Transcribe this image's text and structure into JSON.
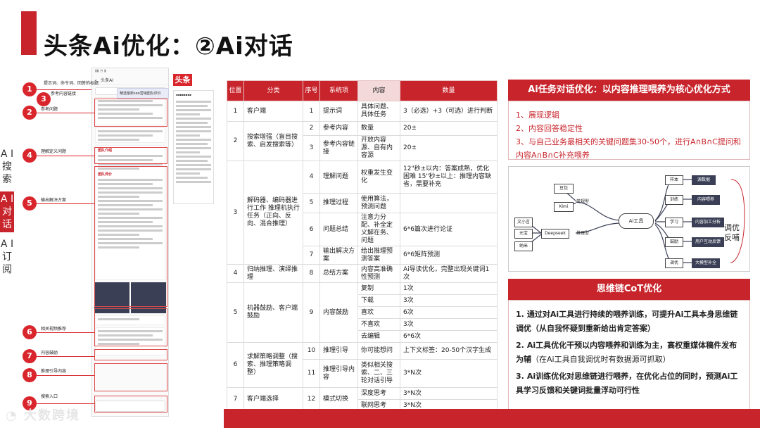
{
  "title": "头条Ai优化：②Ai对话",
  "sidebar": {
    "items": [
      "A I 搜索",
      "A I 对话",
      "A I 订阅"
    ],
    "active": 1
  },
  "logo_text": "大数跨境",
  "phone": {
    "badge": "头条",
    "nav": "头条AI",
    "search_chip": "精选最新seo营销团队评价",
    "sections": [
      "团队介绍",
      "团队评价"
    ],
    "callouts": [
      {
        "n": "1",
        "label": "提示词、命令词、回答的标题"
      },
      {
        "n": "2",
        "label": "参考问题"
      },
      {
        "n": "3",
        "label": "参考内容链接"
      },
      {
        "n": "4",
        "label": "理解定义问题"
      },
      {
        "n": "5",
        "label": "输出解决方案"
      },
      {
        "n": "6",
        "label": "相关视频推荐"
      },
      {
        "n": "7",
        "label": "内容鼓励"
      },
      {
        "n": "8",
        "label": "推理引导内容"
      },
      {
        "n": "9",
        "label": "搜索入口"
      }
    ]
  },
  "table": {
    "headers": [
      "位置",
      "分类",
      "序号",
      "系统项",
      "内容",
      "数量"
    ],
    "groups": [
      {
        "pos": "1",
        "cat": "客户端",
        "rows": [
          {
            "no": "1",
            "item": "提示词",
            "content": "具体问题、具体任务",
            "count": "3（必选）+3（可选）进行判断"
          }
        ]
      },
      {
        "pos": "2",
        "cat": "搜索增强（盲目搜索、启发搜索等）",
        "rows": [
          {
            "no": "2",
            "item": "参考内容",
            "content": "数量",
            "count": "20±"
          },
          {
            "no": "3",
            "item": "参考内容链接",
            "content": "开放内容源、自有内容源",
            "count": "20±"
          }
        ]
      },
      {
        "pos": "3",
        "cat": "解码器、编码器进行工作 推理机执行任务（正向、反向、混合推理）",
        "rows": [
          {
            "no": "4",
            "item": "理解问题",
            "content": "权重发生变化",
            "count": "12\"秒±以内：答案成熟，优化困难 15\"秒±以上：推理内容缺省，需要补充"
          },
          {
            "no": "5",
            "item": "推理过程",
            "content": "使用算法，预测问题",
            "count": ""
          },
          {
            "no": "6",
            "item": "问题总结",
            "content": "注意力分配、补全定义解在务、问题",
            "count": "6*6篇次进行论证"
          },
          {
            "no": "7",
            "item": "输出解决方案",
            "content": "给出推理预测答案",
            "count": "6*6矩阵预测"
          }
        ]
      },
      {
        "pos": "4",
        "cat": "归纳推理、演绎推理",
        "rows": [
          {
            "no": "8",
            "item": "总结方案",
            "content": "内容高准确性预测",
            "count": "Ai导读优化，完整出现关键词1次"
          }
        ]
      },
      {
        "pos": "5",
        "cat": "机器鼓励、客户端鼓励",
        "rows": [
          {
            "no": "9",
            "item": "内容鼓励",
            "content": "复制",
            "count": "1次"
          },
          {
            "no": "",
            "item": "",
            "content": "下载",
            "count": "3次"
          },
          {
            "no": "",
            "item": "",
            "content": "喜欢",
            "count": "6次"
          },
          {
            "no": "",
            "item": "",
            "content": "不喜欢",
            "count": "3次"
          },
          {
            "no": "",
            "item": "",
            "content": "去编辑",
            "count": "6*6次"
          }
        ]
      },
      {
        "pos": "6",
        "cat": "求解策略调整（搜索、推理策略调整）",
        "rows": [
          {
            "no": "10",
            "item": "推理引导",
            "content": "你可能想问",
            "count": "上下文标签：20-50个汉字生成"
          },
          {
            "no": "11",
            "item": "推理引导内容",
            "content": "类似相关搜索、二、三轮对话引导",
            "count": "3*N次"
          }
        ]
      },
      {
        "pos": "7",
        "cat": "客户端选择",
        "rows": [
          {
            "no": "12",
            "item": "模式切换",
            "content": "深度思考",
            "count": "3*N次"
          },
          {
            "no": "",
            "item": "",
            "content": "联网思考",
            "count": "3*N次"
          }
        ]
      }
    ]
  },
  "panel1": {
    "heading": "Ai任务对话优化：以内容推理喂养为核心优化方式",
    "items": [
      "1、展现逻辑",
      "2、内容回答稳定性",
      "3、与自己业务最相关的关键问题集30-50个，进行A∩B∩C提问和内容A∩B∩C补充喂养"
    ]
  },
  "mindmap": {
    "root": "Ai工具",
    "left_top_label": "常规型",
    "left_top_nodes": [
      "豆包",
      "Kimi"
    ],
    "left_bottom_label": "推理型",
    "left_bottom_hub": "Deepseek",
    "left_bottom_nodes": [
      "文小言",
      "元宝",
      "纳米"
    ],
    "right_nodes": [
      {
        "label": "样本",
        "tag": "源数据"
      },
      {
        "label": "训练",
        "tag": "内容喂养"
      },
      {
        "label": "学习",
        "tag": "内容加工分析"
      },
      {
        "label": "鼓励",
        "tag": "用户互动反馈"
      },
      {
        "label": "调优",
        "tag": "大模型补全"
      }
    ],
    "side_text": [
      "调优",
      "反哺"
    ]
  },
  "panel2": {
    "heading": "思维链CoT优化",
    "items": [
      {
        "n": "1.",
        "bold": "通过对Ai工具进行持续的喂养训练，可提升Ai工具本身思维链调优（从自我怀疑到重新给出肯定答案）",
        "plain": ""
      },
      {
        "n": "2.",
        "bold": "Ai工具优化干预以内容喂养和训练为主，高权重媒体稿件发布为辅",
        "plain": "（在Ai工具自我调优时有数据源可抓取）"
      },
      {
        "n": "3.",
        "bold": "Ai训练优化对思维链进行喂养，在优化占位的同时，预测Ai工具学习反馈和关键词批量浮动可行性",
        "plain": ""
      }
    ]
  },
  "colors": {
    "accent": "#c8242b",
    "header_highlight": "#f3d9da"
  }
}
